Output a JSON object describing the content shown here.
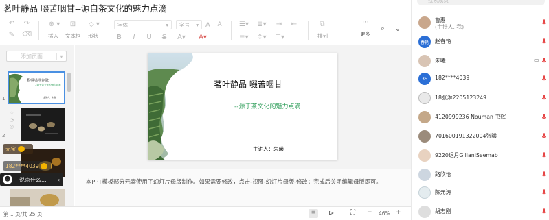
{
  "document": {
    "title": "茗叶静品  啜苦咽甘--源自茶文化的魅力点滴"
  },
  "toolbar": {
    "insert_label": "插入",
    "textbox_label": "文本框",
    "shape_label": "形状",
    "font_placeholder": "字体",
    "font_size_placeholder": "字号",
    "arrange_label": "排列",
    "more_label": "更多"
  },
  "sidebar": {
    "add_slide_label": "添加页面",
    "slide_numbers": [
      "1",
      "2"
    ]
  },
  "slide": {
    "title": "茗叶静品  啜苦咽甘",
    "subtitle_dash": "--",
    "subtitle": "源于茶文化的魅力点滴",
    "presenter": "主讲人：朱曦"
  },
  "thumb1": {
    "title": "茗叶静品  啜苦咽甘",
    "subtitle": "--源于茶文化的魅力点滴",
    "presenter": "主讲人：朱曦"
  },
  "overlays": {
    "reward_label": "元宝",
    "user_label": "182****4039",
    "chat_placeholder": "说点什么..."
  },
  "notes": {
    "text": "本PPT模板部分元素使用了幻灯片母版制作。如果需要修改，点击-视图-幻灯片母版-修改；完成后关闭编辑母版即可。"
  },
  "status": {
    "page_info": "第 1 页/共 25 页",
    "zoom": "46%"
  },
  "members": {
    "search_placeholder": "搜索成员",
    "host_note": "(主持人, 我)",
    "list": [
      {
        "name": "曹惠"
      },
      {
        "name": "赵春艳",
        "avatar_text": "春艳"
      },
      {
        "name": "朱曦"
      },
      {
        "name": "182****4039",
        "avatar_text": "39"
      },
      {
        "name": "18张淋2205123249"
      },
      {
        "name": "4120999236 Nouman 书辉"
      },
      {
        "name": "701600191322004张曦"
      },
      {
        "name": "9220退月GillaniSeemab"
      },
      {
        "name": "路欣怡"
      },
      {
        "name": "陈元涛"
      },
      {
        "name": "胡志刚"
      }
    ]
  },
  "colors": {
    "accent_green": "#2f9e5a",
    "brand_blue": "#2b6fd6",
    "mic_red": "#e64545"
  }
}
